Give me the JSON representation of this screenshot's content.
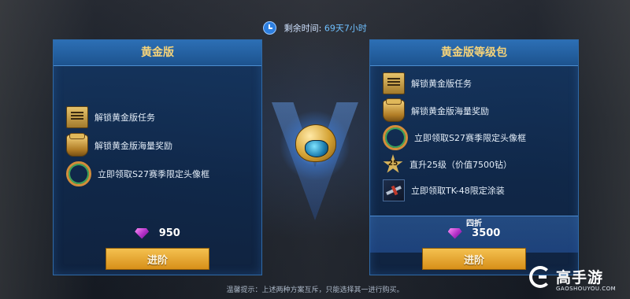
{
  "timer": {
    "label": "剩余时间:",
    "value": "69天7小时"
  },
  "left_panel": {
    "title": "黄金版",
    "benefits": [
      {
        "icon": "scroll-icon",
        "text": "解锁黄金版任务"
      },
      {
        "icon": "gold-pot-icon",
        "text": "解锁黄金版海量奖励"
      },
      {
        "icon": "avatar-frame-icon",
        "text": "立即领取S27赛季限定头像框"
      }
    ],
    "price": "950",
    "button": "进阶"
  },
  "right_panel": {
    "title": "黄金版等级包",
    "benefits": [
      {
        "icon": "scroll-icon",
        "text": "解锁黄金版任务"
      },
      {
        "icon": "gold-pot-icon",
        "text": "解锁黄金版海量奖励"
      },
      {
        "icon": "avatar-frame-icon",
        "text": "立即领取S27赛季限定头像框"
      },
      {
        "icon": "level-star-icon",
        "badge": "25",
        "text": "直升25级（价值7500钻）"
      },
      {
        "icon": "plane-skin-icon",
        "text": "立即领取TK-48限定涂装"
      }
    ],
    "discount": "四折",
    "price": "3500",
    "button": "进阶"
  },
  "tip": "温馨提示：上述两种方案互斥，只能选择其一进行购买。",
  "watermark": {
    "title": "高手游",
    "subtitle": "GAOSHOUYOU.COM"
  },
  "colors": {
    "gold_title": "#f5d37a",
    "button": "#e2a22a",
    "panel": "#163f73",
    "gem": "#c43fd6"
  }
}
